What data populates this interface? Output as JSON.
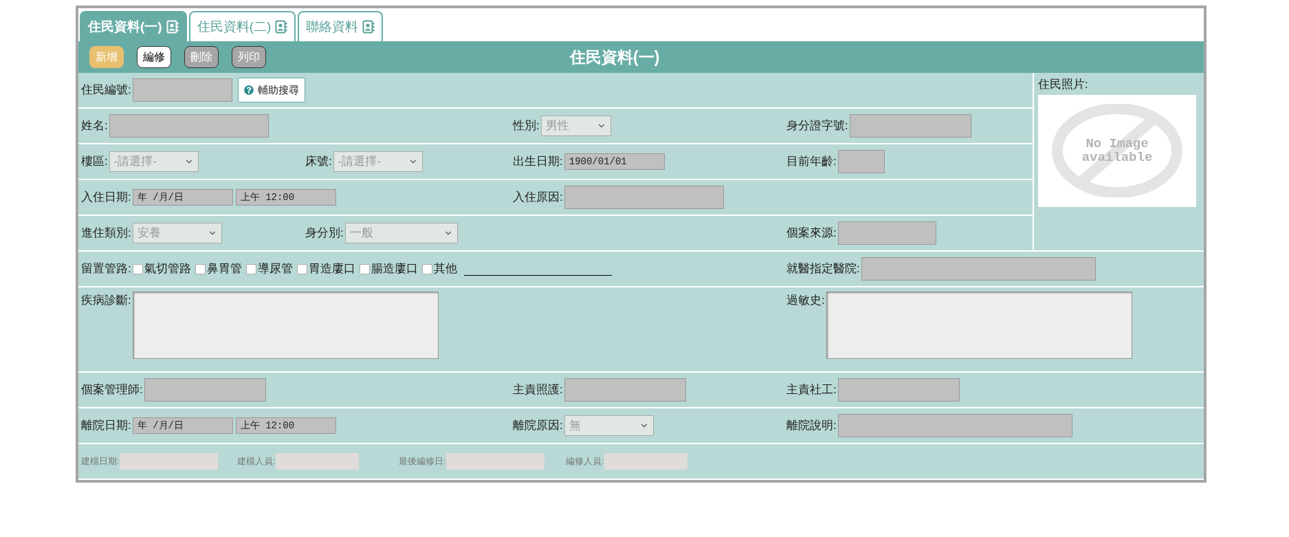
{
  "tabs": [
    {
      "label": "住民資料(一)",
      "selected": true
    },
    {
      "label": "住民資料(二)",
      "selected": false
    },
    {
      "label": "聯絡資料",
      "selected": false
    }
  ],
  "toolbar": {
    "buttons": [
      {
        "label": "新增",
        "kind": "primary"
      },
      {
        "label": "編修",
        "kind": "outline"
      },
      {
        "label": "刪除",
        "kind": "muted"
      },
      {
        "label": "列印",
        "kind": "muted"
      }
    ],
    "title": "住民資料(一)"
  },
  "top_rows": [
    {
      "cells": [
        {
          "label": "住民編號:",
          "fields": [
            {
              "kind": "text"
            },
            {
              "kind": "button",
              "label": "輔助搜尋"
            }
          ]
        },
        null,
        null,
        null
      ]
    },
    {
      "cells": [
        {
          "label": "姓名:",
          "fields": [
            {
              "kind": "text"
            }
          ]
        },
        null,
        {
          "label": "性別:",
          "fields": [
            {
              "kind": "select",
              "value": "男性"
            }
          ]
        },
        {
          "label": "身分證字號:",
          "fields": [
            {
              "kind": "text"
            }
          ]
        }
      ]
    },
    {
      "cells": [
        {
          "label": "樓區:",
          "fields": [
            {
              "kind": "select",
              "value": "-請選擇-"
            }
          ]
        },
        {
          "label": "床號:",
          "fields": [
            {
              "kind": "select",
              "value": "-請選擇-"
            }
          ]
        },
        {
          "label": "出生日期:",
          "fields": [
            {
              "kind": "date",
              "value": "1900/01/01"
            }
          ]
        },
        {
          "label": "目前年齡:",
          "fields": [
            {
              "kind": "text"
            }
          ]
        }
      ]
    },
    {
      "cells": [
        {
          "label": "入住日期:",
          "fields": [
            {
              "kind": "date",
              "value": "年 /月/日"
            },
            {
              "kind": "date",
              "value": "上午 12:00"
            }
          ]
        },
        null,
        {
          "label": "入住原因:",
          "fields": [
            {
              "kind": "text"
            }
          ]
        },
        null
      ]
    },
    {
      "cells": [
        {
          "label": "進住類別:",
          "fields": [
            {
              "kind": "select",
              "value": "安養"
            }
          ]
        },
        {
          "label": "身分別:",
          "fields": [
            {
              "kind": "select",
              "value": "一般"
            }
          ]
        },
        null,
        {
          "label": "個案來源:",
          "fields": [
            {
              "kind": "text"
            }
          ]
        }
      ]
    }
  ],
  "photo": {
    "label": "住民照片:",
    "image_lines": [
      "No Image",
      "available"
    ]
  },
  "rows": [
    {
      "cells": [
        {
          "label": "留置管路:",
          "fields": [
            {
              "kind": "checkbox",
              "label": "氣切管路",
              "checked": false
            },
            {
              "kind": "checkbox",
              "label": "鼻胃管",
              "checked": false
            },
            {
              "kind": "checkbox",
              "label": "導尿管",
              "checked": false
            },
            {
              "kind": "checkbox",
              "label": "胃造廔口",
              "checked": false
            },
            {
              "kind": "checkbox",
              "label": "腸造廔口",
              "checked": false
            },
            {
              "kind": "checkbox",
              "label": "其他",
              "checked": false
            },
            {
              "kind": "line"
            }
          ]
        },
        null,
        null,
        {
          "label": "就醫指定醫院:",
          "fields": [
            {
              "kind": "text"
            }
          ]
        }
      ]
    },
    {
      "cells": [
        {
          "label": "疾病診斷:",
          "fields": [
            {
              "kind": "textarea"
            }
          ]
        },
        null,
        null,
        {
          "label": "過敏史:",
          "fields": [
            {
              "kind": "textarea"
            }
          ]
        }
      ]
    },
    {
      "cells": [
        {
          "label": "個案管理師:",
          "fields": [
            {
              "kind": "text"
            }
          ]
        },
        null,
        {
          "label": "主責照護:",
          "fields": [
            {
              "kind": "text"
            }
          ]
        },
        {
          "label": "主責社工:",
          "fields": [
            {
              "kind": "text"
            }
          ]
        }
      ]
    },
    {
      "cells": [
        {
          "label": "離院日期:",
          "fields": [
            {
              "kind": "date",
              "value": "年 /月/日"
            },
            {
              "kind": "date",
              "value": "上午 12:00"
            }
          ]
        },
        null,
        {
          "label": "離院原因:",
          "fields": [
            {
              "kind": "select",
              "value": "無"
            }
          ]
        },
        {
          "label": "離院說明:",
          "fields": [
            {
              "kind": "text"
            }
          ]
        }
      ]
    }
  ],
  "footer": [
    {
      "label": "建檔日期:"
    },
    {
      "label": "建檔人員:"
    },
    {
      "label": "最後編修日:"
    },
    {
      "label": "編修人員:"
    }
  ]
}
